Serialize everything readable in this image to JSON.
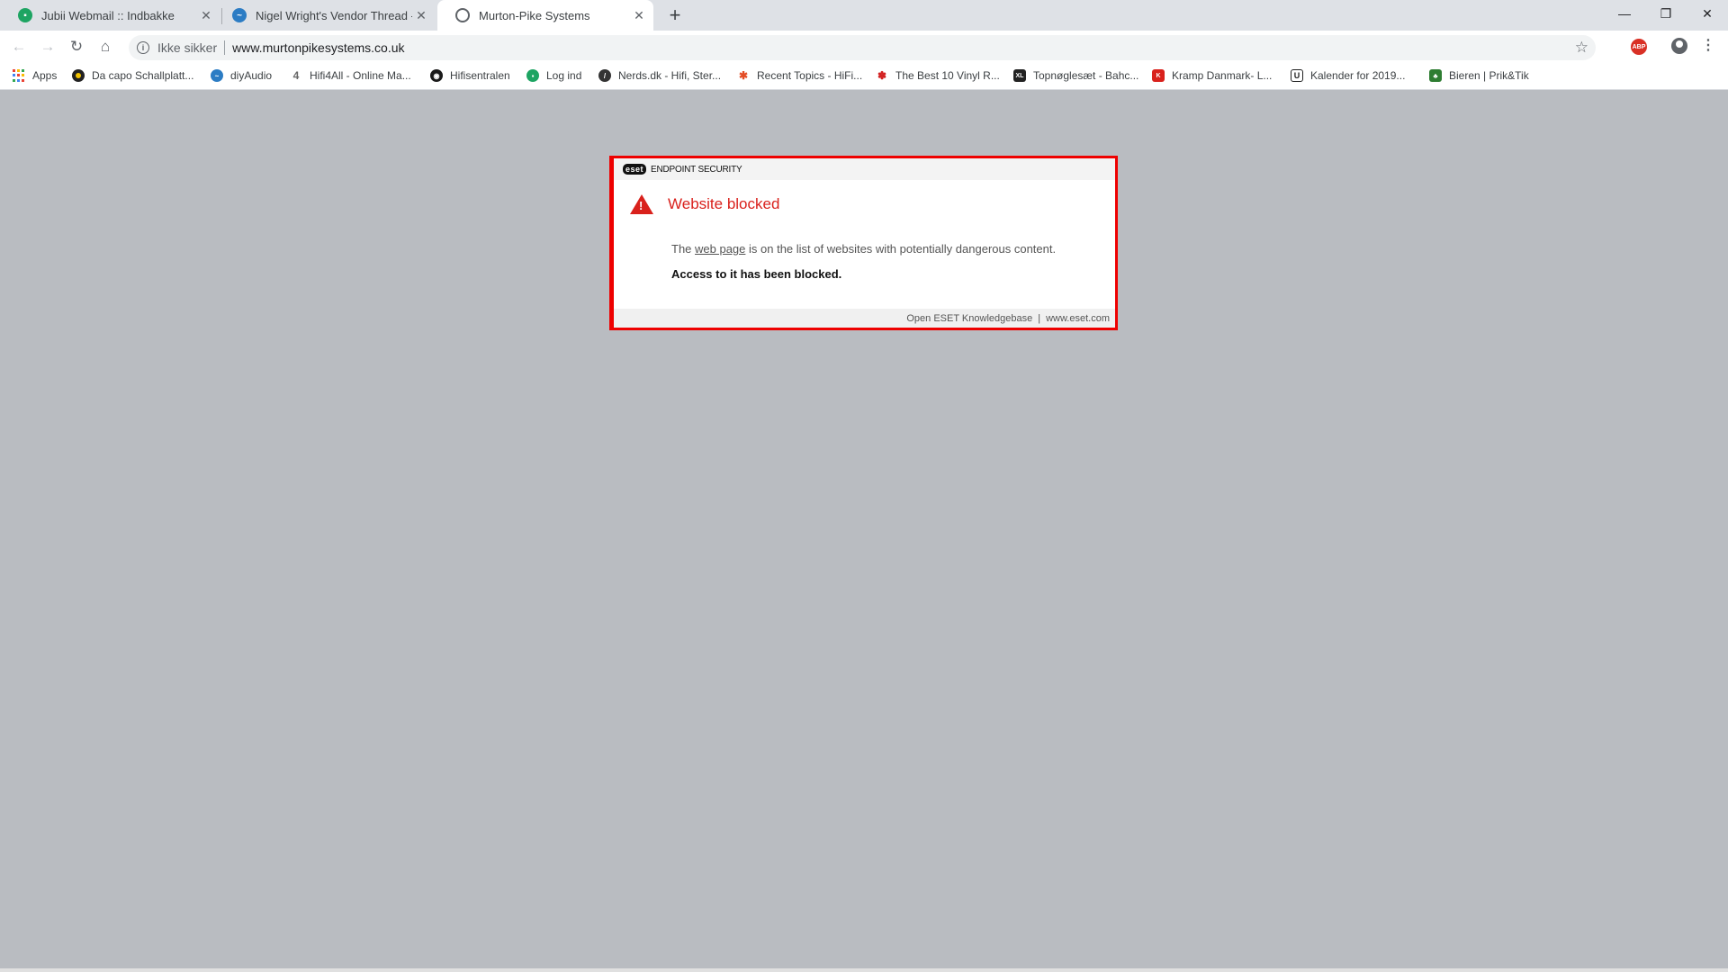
{
  "tabs": [
    {
      "title": "Jubii Webmail :: Indbakke",
      "icon": "jubii-icon",
      "color": "#1da462"
    },
    {
      "title": "Nigel Wright's Vendor Thread - F",
      "icon": "diyaudio-icon",
      "color": "#2c7cc4"
    },
    {
      "title": "Murton-Pike Systems",
      "icon": "globe-icon",
      "color": "#5f6368"
    }
  ],
  "window_controls": {
    "minimize": "—",
    "restore": "❐",
    "close": "✕"
  },
  "toolbar": {
    "back": "←",
    "forward": "→",
    "reload": "↻",
    "home": "⌂",
    "security_label": "Ikke sikker",
    "url": "www.murtonpikesystems.co.uk",
    "star": "☆",
    "abp": "ABP",
    "menu": "⋮"
  },
  "bookmarks": [
    {
      "label": "Apps",
      "icon": "apps-grid-icon",
      "color": "#4285f4"
    },
    {
      "label": "Da capo Schallplatt...",
      "icon": "dacapo-icon",
      "color": "#222222"
    },
    {
      "label": "diyAudio",
      "icon": "diyaudio-icon",
      "color": "#2c7cc4"
    },
    {
      "label": "Hifi4All - Online Ma...",
      "icon": "hifi4all-icon",
      "color": "#666666"
    },
    {
      "label": "Hifisentralen",
      "icon": "hifisentralen-icon",
      "color": "#1a1a1a"
    },
    {
      "label": "Log ind",
      "icon": "login-icon",
      "color": "#1da462"
    },
    {
      "label": "Nerds.dk - Hifi, Ster...",
      "icon": "nerds-icon",
      "color": "#333333"
    },
    {
      "label": "Recent Topics - HiFi...",
      "icon": "joomla-icon",
      "color": "#e44d26"
    },
    {
      "label": "The Best 10 Vinyl R...",
      "icon": "yelp-icon",
      "color": "#d32323"
    },
    {
      "label": "Topnøglesæt - Bahc...",
      "icon": "xl-icon",
      "color": "#222222"
    },
    {
      "label": "Kramp Danmark- L...",
      "icon": "kramp-icon",
      "color": "#d9211c"
    },
    {
      "label": "Kalender for 2019...",
      "icon": "u-icon",
      "color": "#222222"
    },
    {
      "label": "Bieren | Prik&Tik",
      "icon": "bieren-icon",
      "color": "#2e7d32"
    }
  ],
  "eset": {
    "logo": "eset",
    "product": "ENDPOINT SECURITY",
    "title": "Website blocked",
    "text_pre": "The ",
    "text_link": "web page",
    "text_post": " is on the list of websites with potentially dangerous content.",
    "strong": "Access to it has been blocked.",
    "footer_link1": "Open ESET Knowledgebase",
    "footer_sep": "|",
    "footer_link2": "www.eset.com",
    "accent": "#d9211c"
  }
}
